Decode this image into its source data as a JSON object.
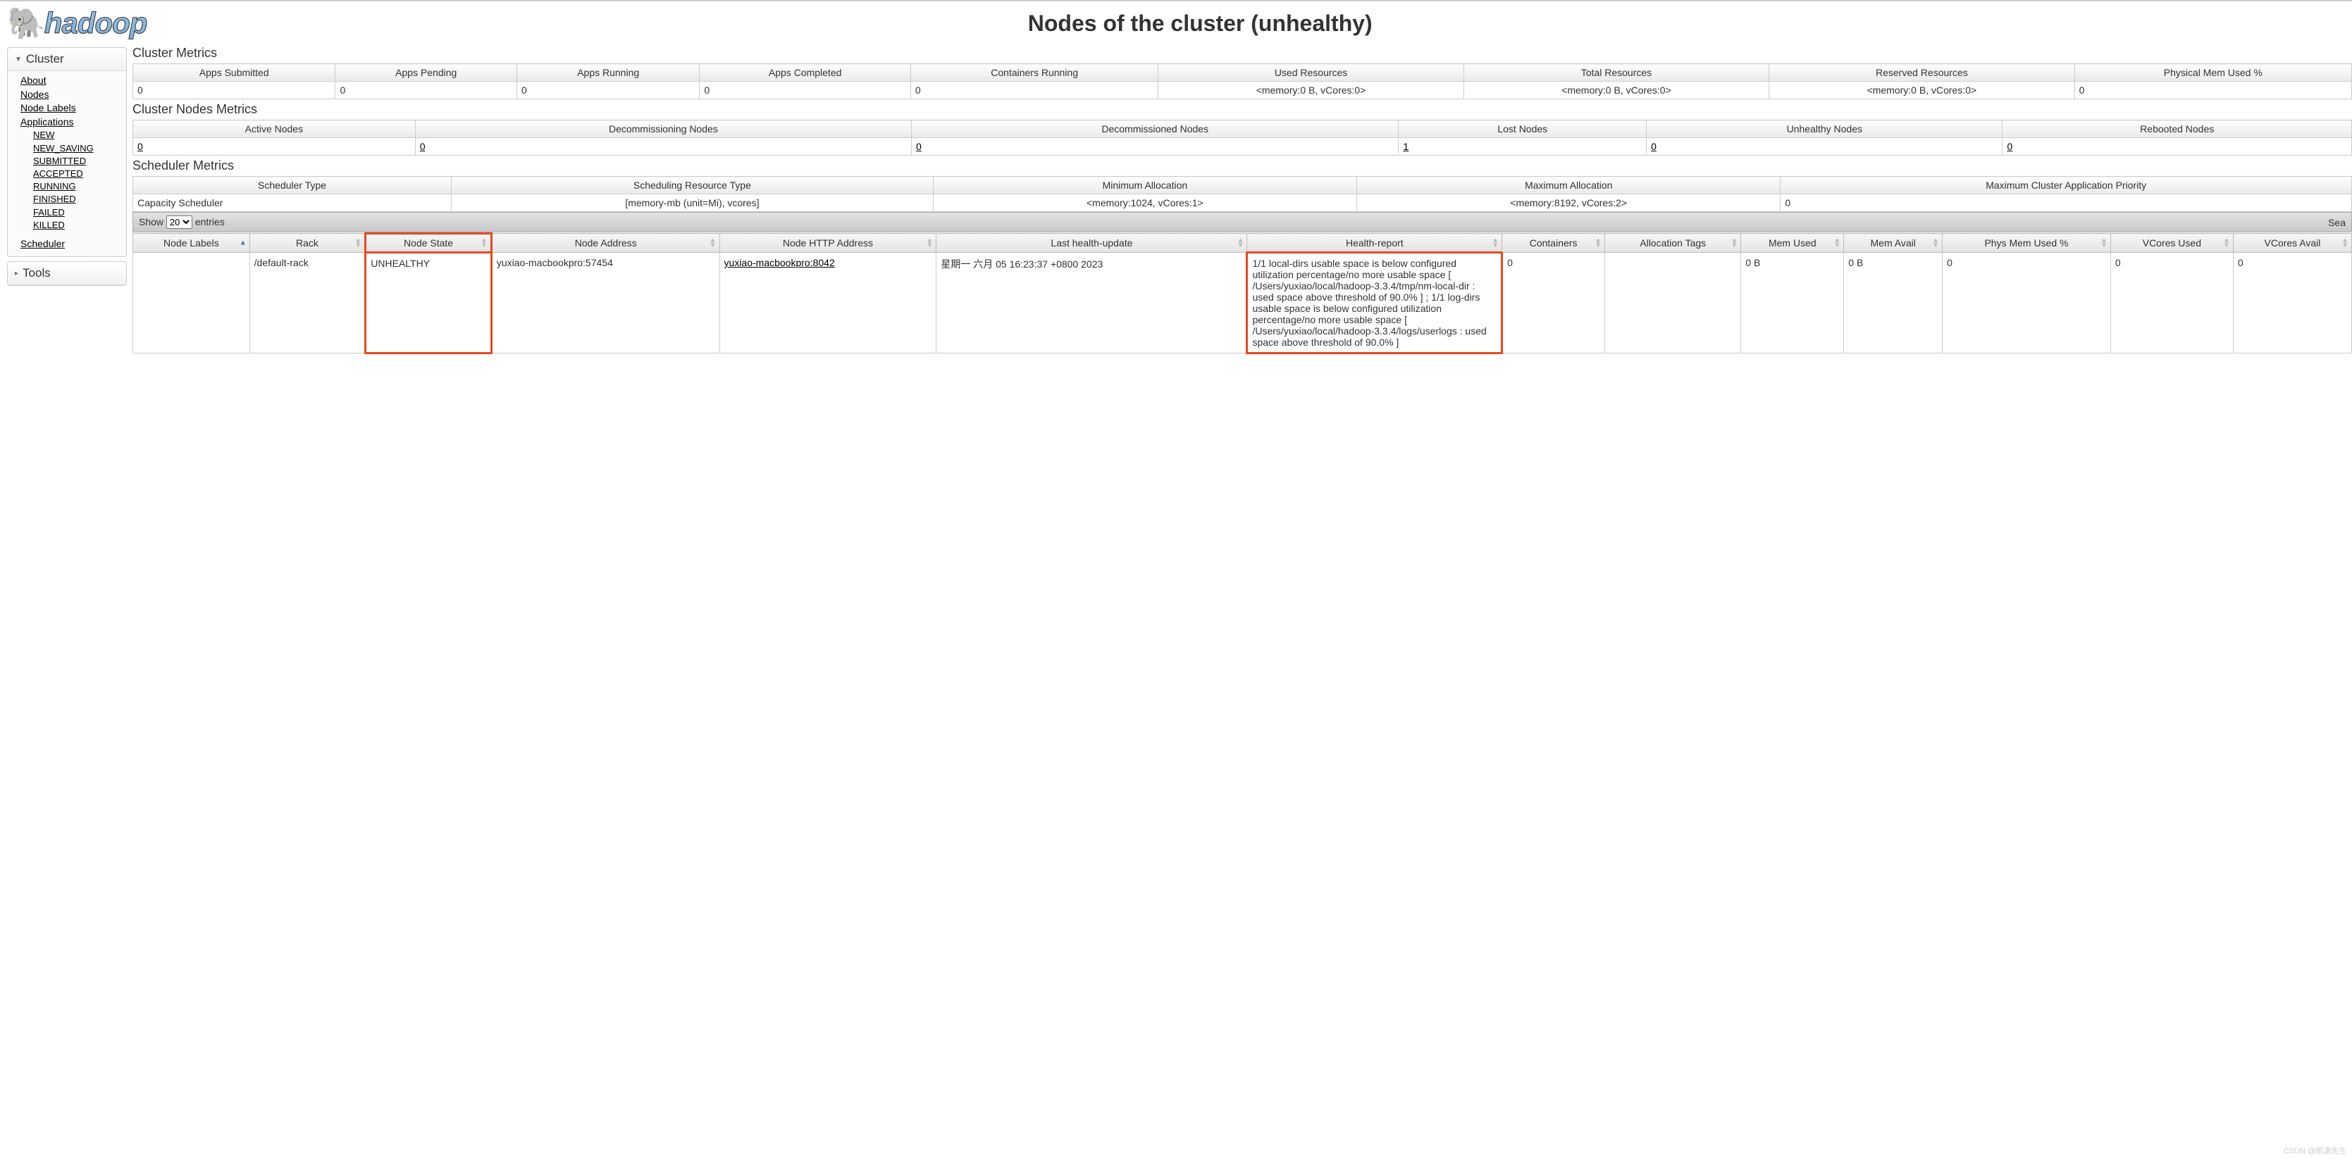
{
  "header": {
    "logo_text": "hadoop",
    "page_title": "Nodes of the cluster (unhealthy)"
  },
  "sidebar": {
    "cluster_label": "Cluster",
    "tools_label": "Tools",
    "links": {
      "about": "About",
      "nodes": "Nodes",
      "node_labels": "Node Labels",
      "applications": "Applications",
      "scheduler": "Scheduler"
    },
    "app_states": [
      "NEW",
      "NEW_SAVING",
      "SUBMITTED",
      "ACCEPTED",
      "RUNNING",
      "FINISHED",
      "FAILED",
      "KILLED"
    ]
  },
  "sections": {
    "cluster_metrics": "Cluster Metrics",
    "cluster_nodes_metrics": "Cluster Nodes Metrics",
    "scheduler_metrics": "Scheduler Metrics"
  },
  "cluster_metrics": {
    "headers": [
      "Apps Submitted",
      "Apps Pending",
      "Apps Running",
      "Apps Completed",
      "Containers Running",
      "Used Resources",
      "Total Resources",
      "Reserved Resources",
      "Physical Mem Used %"
    ],
    "row": [
      "0",
      "0",
      "0",
      "0",
      "0",
      "<memory:0 B, vCores:0>",
      "<memory:0 B, vCores:0>",
      "<memory:0 B, vCores:0>",
      "0"
    ]
  },
  "nodes_metrics": {
    "headers": [
      "Active Nodes",
      "Decommissioning Nodes",
      "Decommissioned Nodes",
      "Lost Nodes",
      "Unhealthy Nodes",
      "Rebooted Nodes"
    ],
    "row": [
      "0",
      "0",
      "0",
      "1",
      "0",
      "0"
    ]
  },
  "scheduler_metrics": {
    "headers": [
      "Scheduler Type",
      "Scheduling Resource Type",
      "Minimum Allocation",
      "Maximum Allocation",
      "Maximum Cluster Application Priority"
    ],
    "row": [
      "Capacity Scheduler",
      "[memory-mb (unit=Mi), vcores]",
      "<memory:1024, vCores:1>",
      "<memory:8192, vCores:2>",
      "0"
    ]
  },
  "datatable": {
    "show_label": "Show",
    "show_value": "20",
    "entries_label": "entries",
    "search_label": "Sea"
  },
  "nodes_table": {
    "headers": [
      "Node Labels",
      "Rack",
      "Node State",
      "Node Address",
      "Node HTTP Address",
      "Last health-update",
      "Health-report",
      "Containers",
      "Allocation Tags",
      "Mem Used",
      "Mem Avail",
      "Phys Mem Used %",
      "VCores Used",
      "VCores Avail"
    ],
    "row": {
      "node_labels": "",
      "rack": "/default-rack",
      "state": "UNHEALTHY",
      "address": "yuxiao-macbookpro:57454",
      "http_address": "yuxiao-macbookpro:8042",
      "last_update": "星期一 六月 05 16:23:37 +0800 2023",
      "health_report": "1/1 local-dirs usable space is below configured utilization percentage/no more usable space [ /Users/yuxiao/local/hadoop-3.3.4/tmp/nm-local-dir : used space above threshold of 90.0% ] ; 1/1 log-dirs usable space is below configured utilization percentage/no more usable space [ /Users/yuxiao/local/hadoop-3.3.4/logs/userlogs : used space above threshold of 90.0% ]",
      "containers": "0",
      "alloc_tags": "",
      "mem_used": "0 B",
      "mem_avail": "0 B",
      "phys_mem": "0",
      "vcores_used": "0",
      "vcores_avail": "0"
    }
  },
  "watermark": "CSDN @雨潇先生"
}
